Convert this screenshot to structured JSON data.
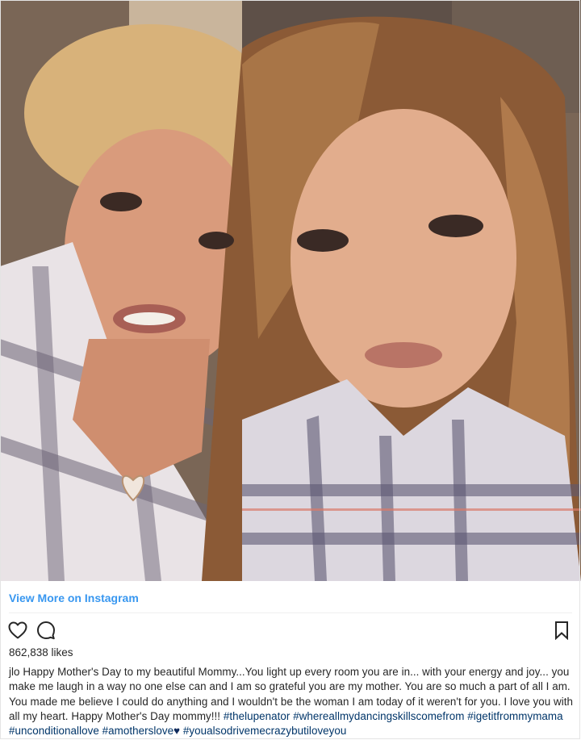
{
  "post": {
    "view_more_label": "View More on Instagram",
    "likes_text": "862,838 likes",
    "username": "jlo",
    "caption_text": "Happy Mother's Day to my beautiful Mommy...You light up every room you are in... with your energy and joy... you make me laugh in a way no one else can and I am so grateful you are my mother. You are so much a part of all I am. You made me believe I could do anything and I wouldn't be the woman I am today of it weren't for you. I love you with all my heart. Happy Mother's Day mommy!!!",
    "hashtags": [
      "#thelupenator",
      "#whereallmydancingskillscomefrom",
      "#igetitfrommymama",
      "#unconditionallove",
      "#amotherslove",
      "#youalsodrivemecrazybutiloveyou"
    ],
    "heart_emoji": "♥"
  },
  "icons": {
    "like": "heart-outline-icon",
    "comment": "speech-bubble-icon",
    "save": "bookmark-icon"
  },
  "colors": {
    "link": "#3897f0",
    "hashtag": "#003569",
    "text": "#262626"
  }
}
